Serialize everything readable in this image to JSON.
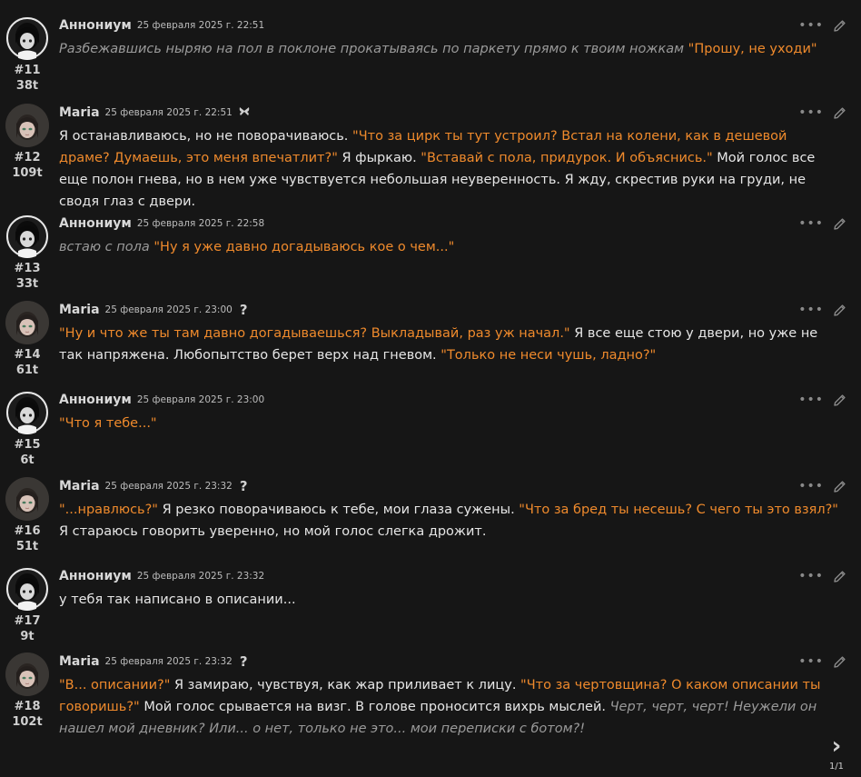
{
  "messages": [
    {
      "num": "#11",
      "tokens": "38t",
      "author": "Аннониум",
      "date": "25 февраля 2025 г. 22:51",
      "badge": "",
      "segments": [
        {
          "kind": "a",
          "text": "Разбежавшись ныряю на пол в поклоне прокатываясь по паркету прямо к твоим ножкам "
        },
        {
          "kind": "q",
          "text": "\"Прошу, не уходи\""
        }
      ]
    },
    {
      "num": "#12",
      "tokens": "109t",
      "author": "Maria",
      "date": "25 февраля 2025 г. 22:51",
      "badge": "butterfly",
      "segments": [
        {
          "kind": "p",
          "text": "Я останавливаюсь, но не поворачиваюсь. "
        },
        {
          "kind": "q",
          "text": "\"Что за цирк ты тут устроил? Встал на колени, как в дешевой драме? Думаешь, это меня впечатлит?\""
        },
        {
          "kind": "p",
          "text": " Я фыркаю. "
        },
        {
          "kind": "q",
          "text": "\"Вставай с пола, придурок. И объяснись.\""
        },
        {
          "kind": "p",
          "text": " Мой голос все еще полон гнева, но в нем уже чувствуется небольшая неуверенность. Я жду, скрестив руки на груди, не сводя глаз с двери."
        }
      ]
    },
    {
      "num": "#13",
      "tokens": "33t",
      "author": "Аннониум",
      "date": "25 февраля 2025 г. 22:58",
      "badge": "",
      "segments": [
        {
          "kind": "a",
          "text": "встаю с пола "
        },
        {
          "kind": "q",
          "text": "\"Ну я уже давно догадываюсь кое о чем...\""
        }
      ]
    },
    {
      "num": "#14",
      "tokens": "61t",
      "author": "Maria",
      "date": "25 февраля 2025 г. 23:00",
      "badge": "?",
      "segments": [
        {
          "kind": "q",
          "text": "\"Ну и что же ты там давно догадываешься? Выкладывай, раз уж начал.\""
        },
        {
          "kind": "p",
          "text": " Я все еще стою у двери, но уже не так напряжена. Любопытство берет верх над гневом. "
        },
        {
          "kind": "q",
          "text": "\"Только не неси чушь, ладно?\""
        }
      ]
    },
    {
      "num": "#15",
      "tokens": "6t",
      "author": "Аннониум",
      "date": "25 февраля 2025 г. 23:00",
      "badge": "",
      "segments": [
        {
          "kind": "q",
          "text": "\"Что я тебе...\""
        }
      ]
    },
    {
      "num": "#16",
      "tokens": "51t",
      "author": "Maria",
      "date": "25 февраля 2025 г. 23:32",
      "badge": "?",
      "segments": [
        {
          "kind": "q",
          "text": "\"...нравлюсь?\""
        },
        {
          "kind": "p",
          "text": " Я резко поворачиваюсь к тебе, мои глаза сужены. "
        },
        {
          "kind": "q",
          "text": "\"Что за бред ты несешь? С чего ты это взял?\""
        },
        {
          "kind": "p",
          "text": " Я стараюсь говорить уверенно, но мой голос слегка дрожит."
        }
      ]
    },
    {
      "num": "#17",
      "tokens": "9t",
      "author": "Аннониум",
      "date": "25 февраля 2025 г. 23:32",
      "badge": "",
      "segments": [
        {
          "kind": "p",
          "text": "у тебя так написано в описании..."
        }
      ]
    },
    {
      "num": "#18",
      "tokens": "102t",
      "author": "Maria",
      "date": "25 февраля 2025 г. 23:32",
      "badge": "?",
      "segments": [
        {
          "kind": "q",
          "text": "\"В... описании?\""
        },
        {
          "kind": "p",
          "text": " Я замираю, чувствуя, как жар приливает к лицу. "
        },
        {
          "kind": "q",
          "text": "\"Что за чертовщина? О каком описании ты говоришь?\""
        },
        {
          "kind": "p",
          "text": " Мой голос срывается на визг. В голове проносится вихрь мыслей. "
        },
        {
          "kind": "a",
          "text": "Черт, черт, черт! Неужели он нашел мой дневник? Или... о нет, только не это... мои переписки с ботом?!"
        }
      ]
    }
  ],
  "pager": {
    "page": "1/1",
    "next_icon": "chevron-right-icon"
  },
  "colors": {
    "background": "#161616",
    "quote": "#ef8a2c",
    "action": "#9a9a9a",
    "text": "#e6e6e6"
  }
}
